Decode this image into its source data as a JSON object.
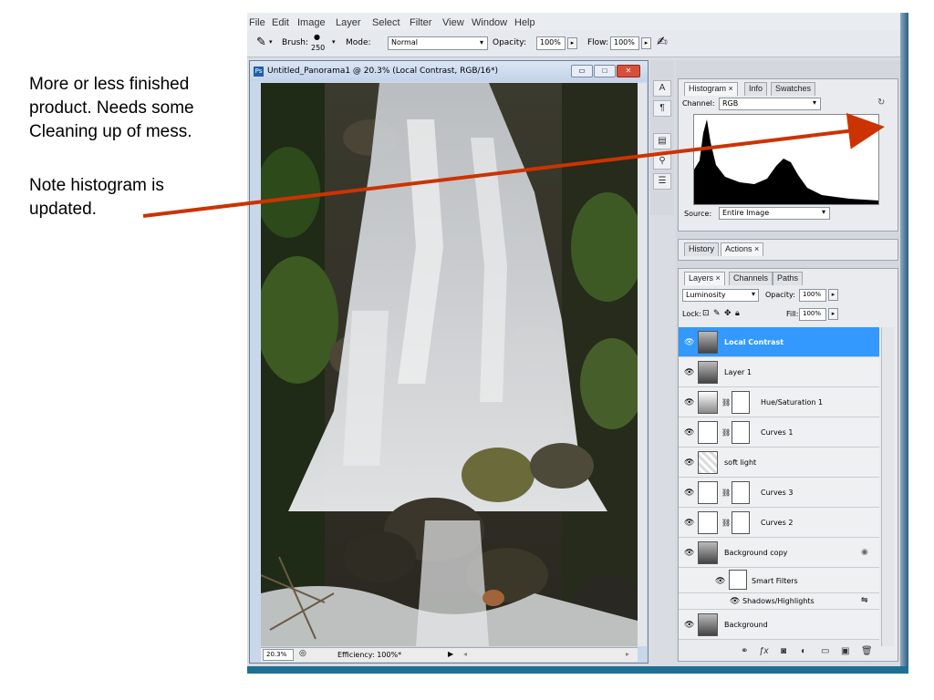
{
  "annotations": {
    "note1": "More or less finished product.  Needs some Cleaning up of mess.",
    "note2": "Note histogram is updated."
  },
  "colors": {
    "arrow": "#cc3300",
    "selected_layer": "#3399ff",
    "window_title": "#c9d7ea"
  },
  "menubar": {
    "items": [
      "File",
      "Edit",
      "Image",
      "Layer",
      "Select",
      "Filter",
      "View",
      "Window",
      "Help"
    ]
  },
  "options": {
    "brush_label": "Brush:",
    "brush_size": "250",
    "mode_label": "Mode:",
    "mode_value": "Normal",
    "opacity_label": "Opacity:",
    "opacity_value": "100%",
    "flow_label": "Flow:",
    "flow_value": "100%"
  },
  "document": {
    "title": "Untitled_Panorama1 @ 20.3% (Local Contrast, RGB/16*)",
    "zoom": "20.3%",
    "status": "Efficiency: 100%*"
  },
  "histogram": {
    "tabs": [
      "Histogram",
      "Info",
      "Swatches"
    ],
    "channel_label": "Channel:",
    "channel_value": "RGB",
    "source_label": "Source:",
    "source_value": "Entire Image"
  },
  "history": {
    "tabs": [
      "History",
      "Actions"
    ]
  },
  "layers_panel": {
    "tabs": [
      "Layers",
      "Channels",
      "Paths"
    ],
    "blend_mode": "Luminosity",
    "opacity_label": "Opacity:",
    "opacity_value": "100%",
    "lock_label": "Lock:",
    "fill_label": "Fill:",
    "fill_value": "100%",
    "layers": [
      {
        "name": "Local Contrast"
      },
      {
        "name": "Layer 1"
      },
      {
        "name": "Hue/Saturation 1"
      },
      {
        "name": "Curves 1"
      },
      {
        "name": "soft light"
      },
      {
        "name": "Curves 3"
      },
      {
        "name": "Curves 2"
      },
      {
        "name": "Background copy"
      },
      {
        "name": "Smart Filters"
      },
      {
        "name": "Shadows/Highlights"
      },
      {
        "name": "Background"
      }
    ]
  }
}
